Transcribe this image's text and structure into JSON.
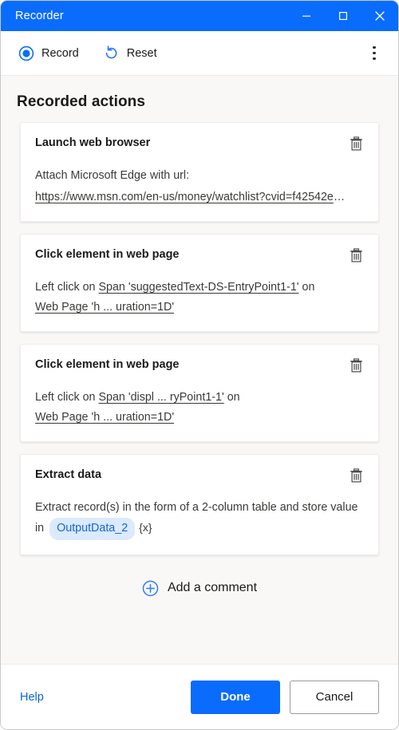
{
  "window": {
    "title": "Recorder",
    "controls": {
      "minimize": "minimize-icon",
      "maximize": "maximize-icon",
      "close": "close-icon"
    },
    "accent_color": "#0a6cfc",
    "background_color": "#f9f8f7"
  },
  "toolbar": {
    "record_label": "Record",
    "record_icon": "record-radio-icon",
    "reset_label": "Reset",
    "reset_icon": "reset-counterclockwise-arrow-icon",
    "more_icon": "more-vertical-icon"
  },
  "main": {
    "section_title": "Recorded actions",
    "actions": [
      {
        "title": "Launch web browser",
        "delete_icon": "trash-icon",
        "description": "Attach Microsoft Edge with url:",
        "url": "https://www.msn.com/en-us/money/watchlist?cvid=f42542e",
        "url_ellipsis": "…"
      },
      {
        "title": "Click element in web page",
        "delete_icon": "trash-icon",
        "prefix": "Left click on",
        "target": "Span 'suggestedText-DS-EntryPoint1-1'",
        "middle": "on",
        "page": "Web Page 'h ... uration=1D'"
      },
      {
        "title": "Click element in web page",
        "delete_icon": "trash-icon",
        "prefix": "Left click on",
        "target": "Span 'displ ... ryPoint1-1'",
        "middle": "on",
        "page": "Web Page 'h ... uration=1D'"
      },
      {
        "title": "Extract data",
        "delete_icon": "trash-icon",
        "description": "Extract record(s) in the form of a 2-column table and store value in",
        "variable": "OutputData_2",
        "variable_marker": "{x}",
        "variable_chip_bg": "#dbeafe",
        "variable_chip_fg": "#1565d8"
      }
    ],
    "add_comment_label": "Add a comment",
    "add_comment_icon": "plus-circle-icon"
  },
  "footer": {
    "help_label": "Help",
    "done_label": "Done",
    "cancel_label": "Cancel"
  }
}
